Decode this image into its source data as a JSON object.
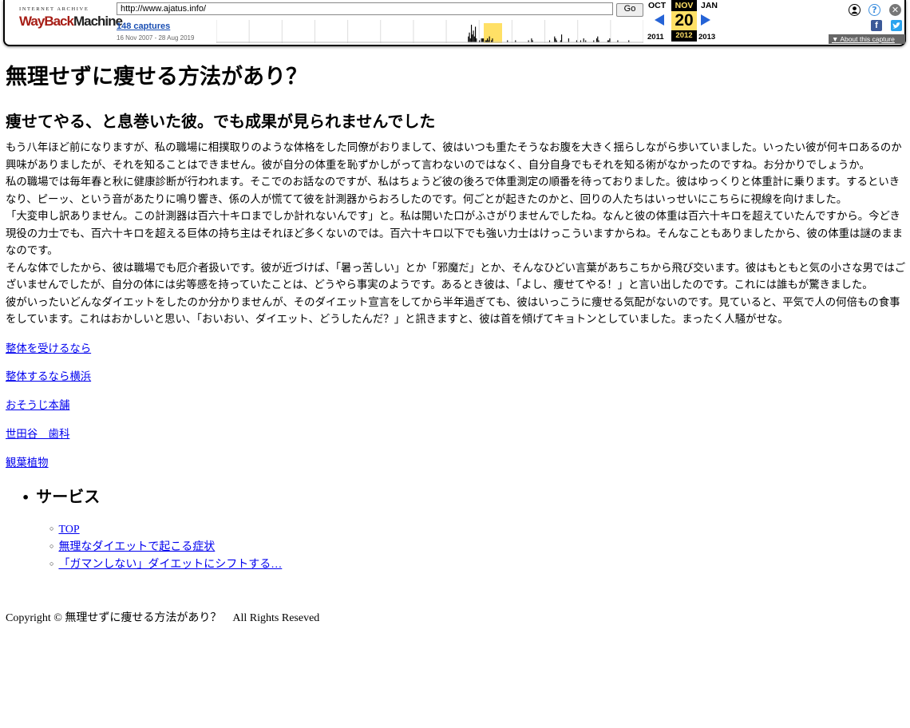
{
  "wayback": {
    "logo_top": "INTERNET ARCHIVE",
    "logo_way": "WayBack",
    "logo_machine": "Machine",
    "url": "http://www.ajatus.info/",
    "go_label": "Go",
    "captures": "148 captures",
    "range": "16 Nov 2007 - 28 Aug 2019",
    "prev_month": "OCT",
    "cur_month": "NOV",
    "next_month": "JAN",
    "cur_day": "20",
    "prev_year": "2011",
    "cur_year": "2012",
    "next_year": "2013",
    "about": "About this capture",
    "accent_color": "#2563d6",
    "highlight_color": "#ffe066",
    "icons": [
      "user-icon",
      "help-icon",
      "close-icon",
      "facebook-icon",
      "twitter-icon"
    ]
  },
  "page": {
    "title": "無理せずに痩せる方法があり？",
    "subtitle": "痩せてやる、と息巻いた彼。でも成果が見られませんでした",
    "body": "もう八年ほど前になりますが、私の職場に相撲取りのような体格をした同僚がおりまして、彼はいつも重たそうなお腹を大きく揺らしながら歩いていました。いったい彼が何キロあるのか興味がありましたが、それを知ることはできません。彼が自分の体重を恥ずかしがって言わないのではなく、自分自身でもそれを知る術がなかったのですね。お分かりでしょうか。\n私の職場では毎年春と秋に健康診断が行われます。そこでのお話なのですが、私はちょうど彼の後ろで体重測定の順番を待っておりました。彼はゆっくりと体重計に乗ります。するといきなり、ピーッ、という音があたりに鳴り響き、係の人が慌てて彼を計測器からおろしたのです。何ごとが起きたのかと、回りの人たちはいっせいにこちらに視線を向けました。\n「大変申し訳ありません。この計測器は百六十キロまでしか計れないんです」と。私は開いた口がふさがりませんでしたね。なんと彼の体重は百六十キロを超えていたんですから。今どき現役の力士でも、百六十キロを超える巨体の持ち主はそれほど多くないのでは。百六十キロ以下でも強い力士はけっこういますからね。そんなこともありましたから、彼の体重は謎のままなのです。\nそんな体でしたから、彼は職場でも厄介者扱いです。彼が近づけば、「暑っ苦しい」とか「邪魔だ」とか、そんなひどい言葉があちこちから飛び交います。彼はもともと気の小さな男ではございませんでしたが、自分の体には劣等感を持っていたことは、どうやら事実のようです。あるとき彼は、「よし、痩せてやる！」と言い出したのです。これには誰もが驚きました。\n彼がいったいどんなダイエットをしたのか分かりませんが、そのダイエット宣言をしてから半年過ぎても、彼はいっこうに痩せる気配がないのです。見ていると、平気で人の何倍もの食事をしています。これはおかしいと思い、「おいおい、ダイエット、どうしたんだ？」と訊きますと、彼は首を傾げてキョトンとしていました。まったく人騒がせな。",
    "links": [
      "整体を受けるなら",
      "整体するなら横浜",
      "おそうじ本舗",
      "世田谷　歯科",
      "観葉植物"
    ],
    "services_title": "サービス",
    "services": [
      "TOP",
      "無理なダイエットで起こる症状",
      "「ガマンしない」ダイエットにシフトする…"
    ],
    "copyright": "Copyright © 無理せずに痩せる方法があり？　All Rights Reseved"
  },
  "chart_data": {
    "type": "bar",
    "title": "",
    "note": "Wayback capture histogram (relative heights, 2007–2019)",
    "values": [
      0,
      0,
      0,
      0,
      0,
      0,
      0,
      0,
      0,
      0,
      0,
      0,
      0,
      0,
      0,
      0,
      0,
      0,
      0,
      0,
      0,
      0,
      0,
      0,
      0,
      0,
      0,
      0,
      0,
      0,
      0,
      0,
      0,
      0,
      0,
      0,
      0,
      0,
      0,
      0,
      0,
      0,
      0,
      0,
      0,
      0,
      0,
      0,
      0,
      0,
      0,
      0,
      0,
      0,
      0,
      0,
      0,
      0,
      0,
      0,
      0,
      0,
      0,
      0,
      0,
      0,
      0,
      0,
      0,
      0,
      0,
      0,
      0,
      0,
      0,
      0,
      0,
      0,
      0,
      0,
      0,
      0,
      0,
      0,
      0,
      0,
      0,
      0,
      0,
      0,
      0,
      0,
      0,
      0,
      0,
      0,
      0,
      0,
      0,
      0,
      0,
      0,
      0,
      0,
      0,
      0,
      0,
      0,
      0,
      0,
      0,
      0,
      0,
      0,
      0,
      0,
      0,
      0,
      0,
      0,
      0,
      0,
      0,
      0,
      0,
      0,
      0,
      0,
      0,
      0,
      0,
      0,
      0,
      0,
      0,
      0,
      0,
      0,
      0,
      0,
      0,
      0,
      0,
      0,
      0,
      0,
      0,
      0,
      0,
      0,
      0,
      0,
      0,
      0,
      0,
      0,
      0,
      0,
      0,
      0,
      0,
      0,
      0,
      0,
      0,
      0,
      0,
      0,
      0,
      0,
      0,
      0,
      0,
      0,
      0,
      0,
      0,
      0,
      0,
      0,
      0,
      0,
      0,
      0,
      0,
      0,
      0,
      0,
      0,
      0,
      0,
      0,
      0,
      0,
      0,
      0,
      0,
      0,
      0,
      0,
      0,
      0,
      0,
      0,
      0,
      0,
      0,
      0,
      0,
      0,
      0,
      0,
      0,
      0,
      0,
      0,
      0,
      0,
      0,
      0,
      0,
      0,
      0,
      0,
      0,
      0,
      0,
      0,
      0,
      0,
      0,
      0,
      0,
      0,
      0,
      0,
      0,
      0,
      0,
      0,
      0,
      0,
      0,
      0,
      0,
      0,
      0,
      0,
      0,
      0,
      0,
      3,
      5,
      2,
      9,
      4,
      6,
      3,
      8,
      2,
      0,
      0,
      1,
      0,
      2,
      2,
      2,
      0,
      1,
      1,
      2,
      1,
      3,
      0,
      1,
      2,
      0,
      0,
      0,
      0,
      0,
      0,
      0,
      0,
      0,
      0,
      0,
      0,
      0,
      0,
      1,
      0,
      0,
      0,
      0,
      0,
      0,
      0,
      1,
      0,
      0,
      0,
      0,
      0,
      0,
      0,
      0,
      0,
      0,
      0,
      0,
      1,
      0,
      0,
      2,
      1,
      0,
      0,
      0,
      0,
      0,
      0,
      0,
      0,
      0,
      0,
      0,
      0,
      0,
      0,
      0,
      0,
      1,
      0,
      0,
      0,
      0,
      3,
      2,
      1,
      0,
      0,
      0,
      1,
      4,
      0,
      0,
      0,
      0,
      0,
      0,
      2,
      0,
      0,
      0,
      0,
      0,
      0,
      0,
      1,
      0,
      0,
      0,
      1,
      0,
      0,
      2,
      0,
      1,
      0,
      0,
      0,
      0,
      0,
      0,
      0,
      1,
      0,
      0,
      2,
      3,
      1,
      0,
      0,
      0,
      0,
      0,
      0,
      0,
      0,
      1,
      1,
      2,
      0,
      0,
      0,
      0,
      0,
      0,
      0,
      1,
      0,
      0,
      0,
      0,
      0,
      0,
      0,
      0,
      0,
      0,
      1,
      0,
      0,
      0,
      0,
      0,
      0,
      0,
      0,
      0,
      0,
      0,
      0,
      0,
      0
    ]
  }
}
